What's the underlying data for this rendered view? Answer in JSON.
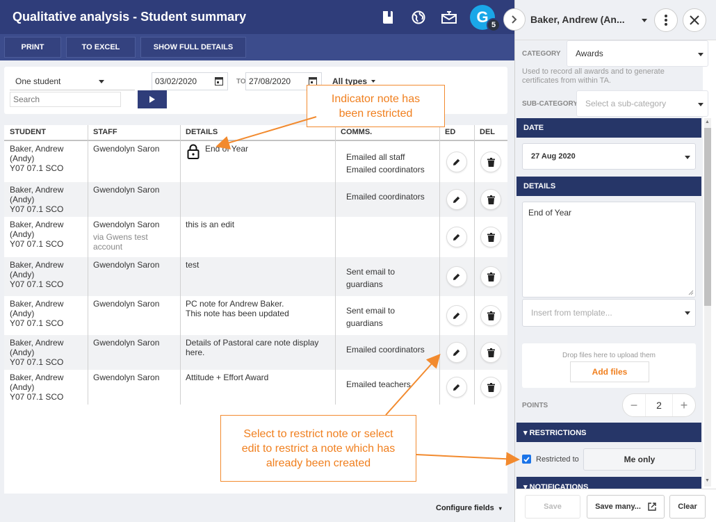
{
  "header": {
    "title": "Qualitative analysis - Student summary",
    "avatar_letter": "G",
    "avatar_badge": "5"
  },
  "toolbar": {
    "print": "PRINT",
    "excel": "TO EXCEL",
    "full": "SHOW FULL DETAILS"
  },
  "filters": {
    "scope": "One student",
    "date_from": "03/02/2020",
    "to_label": "TO",
    "date_to": "27/08/2020",
    "types": "All types",
    "search_placeholder": "Search"
  },
  "table": {
    "headers": [
      "STUDENT",
      "STAFF",
      "DETAILS",
      "COMMS.",
      "ED",
      "DEL"
    ],
    "rows": [
      {
        "student": "Baker, Andrew\n(Andy)\nY07 07.1 SCO",
        "staff": "Gwendolyn Saron",
        "via": "",
        "details": "End of Year",
        "comms": "Emailed all staff\nEmailed coordinators",
        "locked": true
      },
      {
        "student": "Baker, Andrew\n(Andy)\nY07 07.1 SCO",
        "staff": "Gwendolyn Saron",
        "via": "",
        "details": "",
        "comms": "Emailed coordinators",
        "locked": false
      },
      {
        "student": "Baker, Andrew\n(Andy)\nY07 07.1 SCO",
        "staff": "Gwendolyn Saron",
        "via": "via Gwens test\naccount",
        "details": "this is an edit",
        "comms": "",
        "locked": false
      },
      {
        "student": "Baker, Andrew\n(Andy)\nY07 07.1 SCO",
        "staff": "Gwendolyn Saron",
        "via": "",
        "details": "test",
        "comms": "Sent email to\nguardians",
        "locked": false
      },
      {
        "student": "Baker, Andrew\n(Andy)\nY07 07.1 SCO",
        "staff": "Gwendolyn Saron",
        "via": "",
        "details": "PC note for Andrew Baker.\nThis note has been updated",
        "comms": "Sent email to\nguardians",
        "locked": false
      },
      {
        "student": "Baker, Andrew\n(Andy)\nY07 07.1 SCO",
        "staff": "Gwendolyn Saron",
        "via": "",
        "details": "Details of Pastoral care note display\nhere.",
        "comms": "Emailed coordinators",
        "locked": false
      },
      {
        "student": "Baker, Andrew\n(Andy)\nY07 07.1 SCO",
        "staff": "Gwendolyn Saron",
        "via": "",
        "details": "Attitude + Effort Award",
        "comms": "Emailed teachers",
        "locked": false
      }
    ],
    "configure": "Configure fields"
  },
  "panel": {
    "student_name": "Baker, Andrew (An...",
    "category_label": "CATEGORY",
    "category_value": "Awards",
    "category_desc": "Used to record all awards and to generate certificates from within TA.",
    "subcat_label": "SUB-CATEGORY",
    "subcat_placeholder": "Select a sub-category",
    "date_header": "DATE",
    "date_value": "27 Aug 2020",
    "details_header": "DETAILS",
    "details_value": "End of Year",
    "template_placeholder": "Insert from template...",
    "drop_text": "Drop files here to upload them",
    "add_files": "Add files",
    "points_label": "POINTS",
    "points_minus": "−",
    "points_value": "2",
    "points_plus": "+",
    "restrictions_header": "▾ RESTRICTIONS",
    "restricted_label": "Restricted to",
    "restricted_value": "Me only",
    "notifications_header": "▾ NOTIFICATIONS",
    "save": "Save",
    "save_many": "Save many...",
    "clear": "Clear"
  },
  "annotations": {
    "top": "Indicator note has\nbeen restricted",
    "bottom": "Select  to restrict note or select\nedit to restrict a note which has\nalready been created"
  },
  "colors": {
    "header": "#2f3d7a",
    "section": "#263668",
    "accent": "#f28a2e",
    "avatar": "#1aa7e8"
  }
}
